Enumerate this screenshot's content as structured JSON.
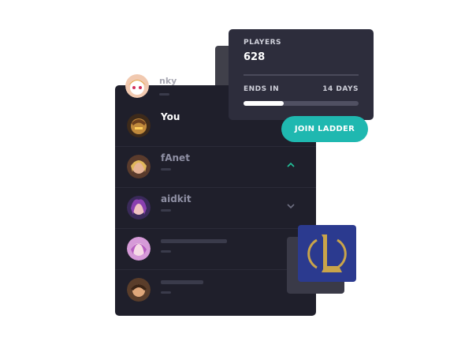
{
  "stats": {
    "players_label": "PLAYERS",
    "players_value": "628",
    "ends_label": "ENDS IN",
    "ends_value": "14 DAYS",
    "progress": 0.35
  },
  "join_button": "JOIN LADDER",
  "top_player": {
    "name": "nky"
  },
  "players": [
    {
      "name": "You",
      "style": "bright",
      "chevron": ""
    },
    {
      "name": "fAnet",
      "style": "dim",
      "chevron": "up"
    },
    {
      "name": "aidkit",
      "style": "dim",
      "chevron": "down"
    },
    {
      "name": "",
      "style": "placeholder",
      "chevron": ""
    },
    {
      "name": "",
      "style": "placeholder",
      "chevron": "down"
    }
  ],
  "colors": {
    "accent": "#1fb8b0",
    "panel": "#1f1f2b",
    "card": "#2d2d3c",
    "logo_bg": "#2b3a8f",
    "logo_gold": "#c9a44a",
    "chevron_up": "#22c39b"
  },
  "icons": {
    "chevron_up": "chevron-up-icon",
    "chevron_down": "chevron-down-icon",
    "logo": "league-logo-icon"
  }
}
